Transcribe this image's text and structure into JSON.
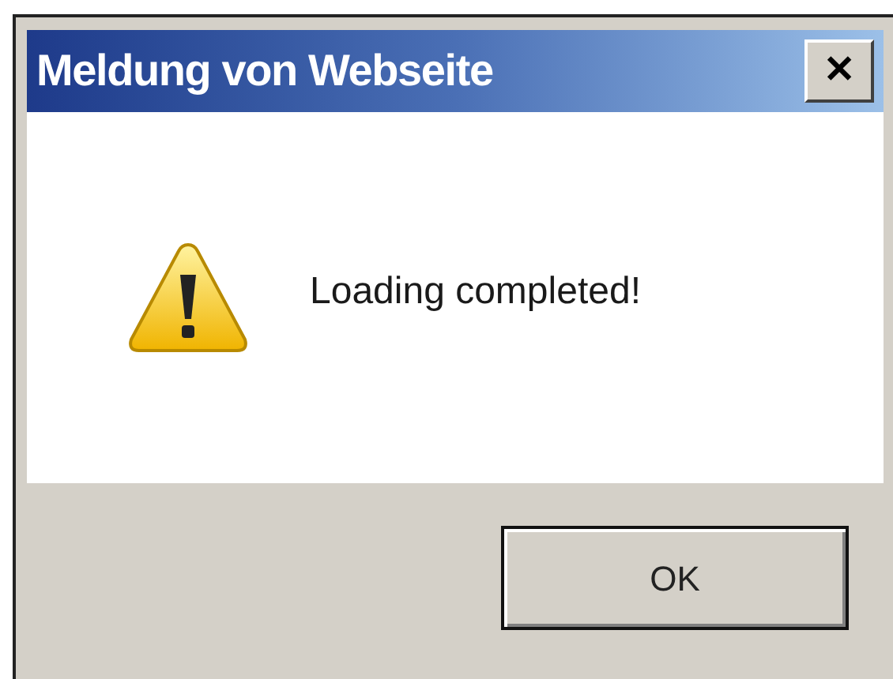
{
  "window": {
    "title": "Meldung von Webseite",
    "close": "✕"
  },
  "message": "Loading completed!",
  "buttons": [
    "OK"
  ]
}
